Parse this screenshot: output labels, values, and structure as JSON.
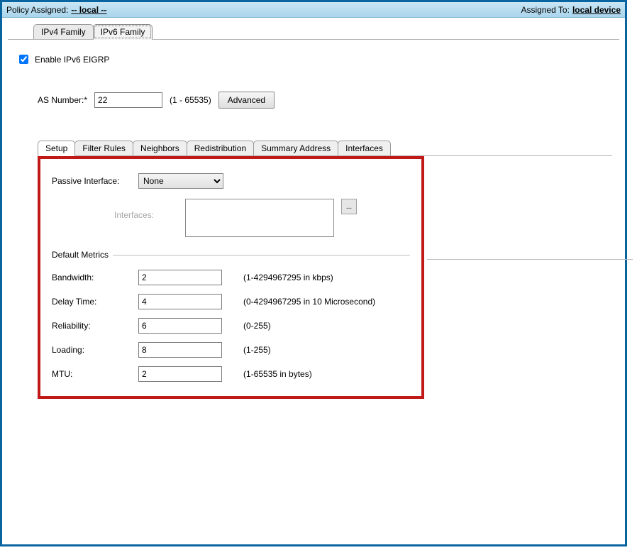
{
  "titlebar": {
    "policy_label": "Policy Assigned:",
    "policy_value": "-- local --",
    "assigned_label": "Assigned To:",
    "assigned_value": "local device"
  },
  "top_tabs": {
    "ipv4": "IPv4 Family",
    "ipv6": "IPv6 Family"
  },
  "ipv6_panel": {
    "enable_label": "Enable IPv6 EIGRP",
    "as_label": "AS Number:*",
    "as_value": "22",
    "as_range": "(1 - 65535)",
    "advanced_btn": "Advanced"
  },
  "inner_tabs": {
    "setup": "Setup",
    "filter": "Filter Rules",
    "neighbors": "Neighbors",
    "redistribution": "Redistribution",
    "summary": "Summary Address",
    "interfaces": "Interfaces"
  },
  "setup": {
    "passive_if_label": "Passive Interface:",
    "passive_if_value": "None",
    "interfaces_label": "Interfaces:",
    "browse_label": "...",
    "default_metrics_label": "Default Metrics",
    "bandwidth": {
      "label": "Bandwidth:",
      "value": "2",
      "hint": "(1-4294967295 in kbps)"
    },
    "delay": {
      "label": "Delay Time:",
      "value": "4",
      "hint": "(0-4294967295 in 10 Microsecond)"
    },
    "reliability": {
      "label": "Reliability:",
      "value": "6",
      "hint": "(0-255)"
    },
    "loading": {
      "label": "Loading:",
      "value": "8",
      "hint": "(1-255)"
    },
    "mtu": {
      "label": "MTU:",
      "value": "2",
      "hint": "(1-65535 in bytes)"
    }
  }
}
